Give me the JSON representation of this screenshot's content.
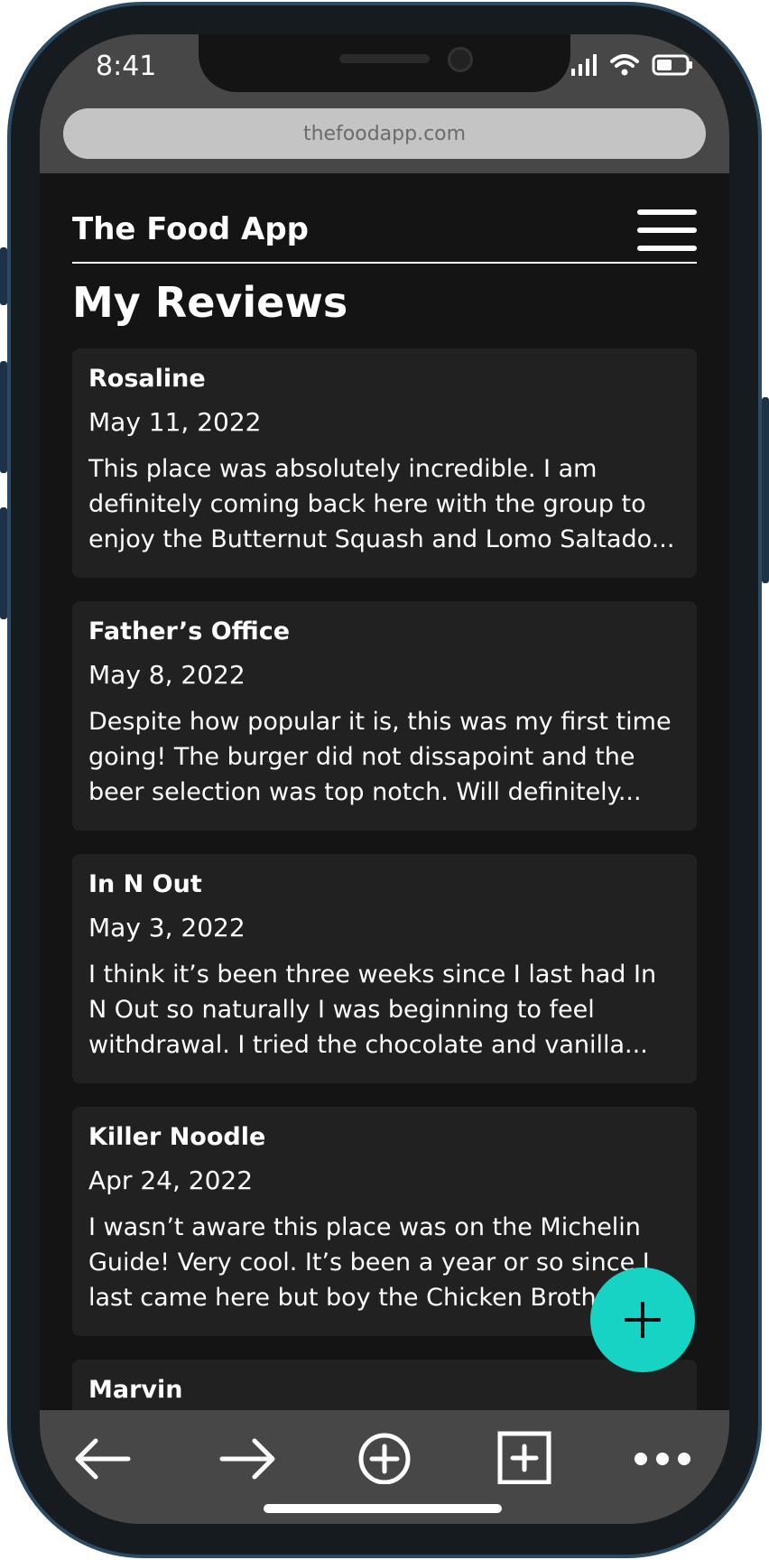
{
  "status_bar": {
    "time": "8:41"
  },
  "browser": {
    "url": "thefoodapp.com"
  },
  "header": {
    "app_title": "The Food App"
  },
  "page": {
    "title": "My Reviews"
  },
  "reviews": [
    {
      "name": "Rosaline",
      "date": "May 11, 2022",
      "text": "This place was absolutely incredible. I am definitely coming back here with the group to enjoy the Butternut Squash and Lomo Saltado..."
    },
    {
      "name": "Father’s Office",
      "date": "May 8, 2022",
      "text": "Despite how popular it is, this was my first time going! The burger did not dissapoint and the beer selection was top notch. Will definitely..."
    },
    {
      "name": "In N Out",
      "date": "May 3, 2022",
      "text": "I think it’s been three weeks since I last had In N Out so naturally I was beginning to feel withdrawal. I tried the chocolate and vanilla..."
    },
    {
      "name": "Killer Noodle",
      "date": "Apr 24, 2022",
      "text": "I wasn’t aware this place was on the Michelin Guide! Very cool. It’s been a year or so since I last came here but boy the Chicken Broth..."
    },
    {
      "name": "Marvin",
      "date": "",
      "text": ""
    }
  ],
  "icons": {
    "menu": "hamburger-icon",
    "add_review": "plus-icon",
    "back": "arrow-left-icon",
    "forward": "arrow-right-icon",
    "new_tab": "plus-circle-icon",
    "tabs": "plus-square-icon",
    "more": "more-dots-icon"
  },
  "colors": {
    "accent": "#17d3c4",
    "background": "#141414",
    "card": "#212121",
    "browser_chrome": "#474747"
  }
}
